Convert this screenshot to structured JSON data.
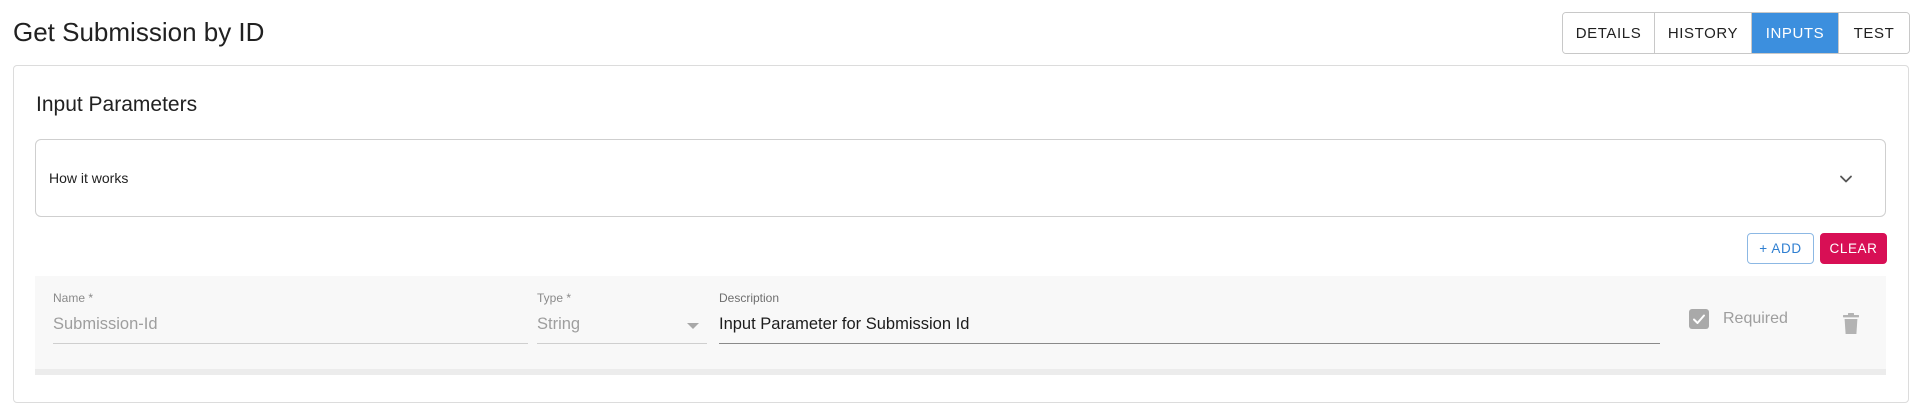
{
  "page": {
    "title": "Get Submission by ID"
  },
  "tabs": [
    {
      "label": "DETAILS",
      "active": false
    },
    {
      "label": "HISTORY",
      "active": false
    },
    {
      "label": "INPUTS",
      "active": true
    },
    {
      "label": "TEST",
      "active": false
    }
  ],
  "section": {
    "title": "Input Parameters"
  },
  "accordion": {
    "label": "How it works",
    "icon": "chevron-down-icon",
    "expanded": false
  },
  "actions": {
    "add_label": "+ ADD",
    "clear_label": "CLEAR"
  },
  "parameters": [
    {
      "name_label": "Name *",
      "name_value": "Submission-Id",
      "type_label": "Type *",
      "type_value": "String",
      "description_label": "Description",
      "description_value": "Input Parameter for Submission Id",
      "required_label": "Required",
      "required_checked": true
    }
  ],
  "colors": {
    "accent": "#3c8fde",
    "danger": "#d80f55",
    "add_text": "#2f7fd1"
  }
}
